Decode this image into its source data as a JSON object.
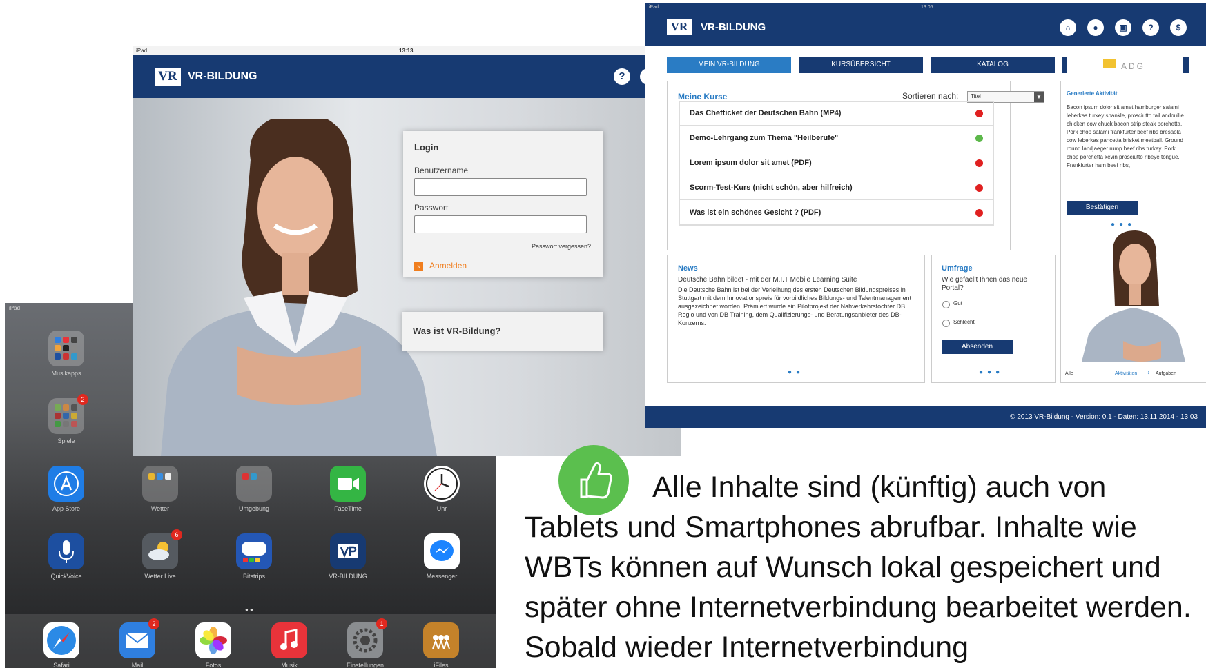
{
  "home": {
    "status": "iPad",
    "folders": [
      {
        "label": "Musikapps"
      },
      {
        "label": "Spiele",
        "badge": "2"
      }
    ],
    "apps_row1": [
      {
        "label": "App Store",
        "icon": "app-store-icon",
        "color": "#1f7de6"
      },
      {
        "label": "Wetter",
        "icon": "folder-icon",
        "color": "#6b6b6b"
      },
      {
        "label": "Umgebung",
        "icon": "folder-icon",
        "color": "#7b7b7b"
      },
      {
        "label": "FaceTime",
        "icon": "facetime-icon",
        "color": "#34b544"
      },
      {
        "label": "Uhr",
        "icon": "clock-icon",
        "color": "#ffffff"
      }
    ],
    "apps_row2": [
      {
        "label": "QuickVoice",
        "icon": "microphone-icon",
        "color": "#1d4fa0"
      },
      {
        "label": "Wetter Live",
        "icon": "weather-icon",
        "color": "#555a60",
        "badge": "6"
      },
      {
        "label": "Bitstrips",
        "icon": "speech-bubble-icon",
        "color": "#2457b5"
      },
      {
        "label": "VR-BILDUNG",
        "icon": "vr-logo-icon",
        "color": "#173a72"
      },
      {
        "label": "Messenger",
        "icon": "messenger-icon",
        "color": "#ffffff"
      }
    ],
    "dock": [
      {
        "label": "Safari",
        "icon": "safari-icon",
        "color": "#2b8ae6"
      },
      {
        "label": "Mail",
        "icon": "mail-icon",
        "color": "#2f7fe0",
        "badge": "2"
      },
      {
        "label": "Fotos",
        "icon": "photos-icon",
        "color": "#ffffff"
      },
      {
        "label": "Musik",
        "icon": "music-icon",
        "color": "#e8333a"
      },
      {
        "label": "Einstellungen",
        "icon": "settings-icon",
        "color": "#8a8d90",
        "badge": "1"
      },
      {
        "label": "iFiles",
        "icon": "files-icon",
        "color": "#c4822a"
      }
    ]
  },
  "login": {
    "status_left": "iPad",
    "status_time": "13:13",
    "brand": "VR-BILDUNG",
    "logo": "VR",
    "help": "?",
    "title": "Login",
    "username_label": "Benutzername",
    "password_label": "Passwort",
    "forgot": "Passwort vergessen?",
    "submit": "Anmelden",
    "info": "Was ist VR-Bildung?"
  },
  "portal": {
    "status_left": "iPad",
    "status_time": "13:05",
    "brand": "VR-BILDUNG",
    "logo": "VR",
    "header_icons": [
      "home-icon",
      "user-icon",
      "lock-icon",
      "help-icon",
      "dollar-icon"
    ],
    "header_glyphs": [
      "⌂",
      "●",
      "▣",
      "?",
      "$"
    ],
    "nav": [
      "MEIN VR-BILDUNG",
      "KURSÜBERSICHT",
      "KATALOG"
    ],
    "adg": "ADG",
    "courses_title": "Meine Kurse",
    "sort_label": "Sortieren nach:",
    "sort_value": "Titel",
    "courses": [
      {
        "title": "Das Chefticket der Deutschen Bahn (MP4)",
        "status": "#e02020"
      },
      {
        "title": "Demo-Lehrgang zum Thema \"Heilberufe\"",
        "status": "#5cb84a"
      },
      {
        "title": "Lorem ipsum dolor sit amet (PDF)",
        "status": "#e02020"
      },
      {
        "title": "Scorm-Test-Kurs (nicht schön, aber hilfreich)",
        "status": "#e02020"
      },
      {
        "title": "Was ist ein schönes Gesicht ? (PDF)",
        "status": "#e02020"
      }
    ],
    "activity_title": "Generierte Aktivität",
    "activity_text": "Bacon ipsum dolor sit amet hamburger salami leberkas turkey shankle, prosciutto tail andouille chicken cow chuck bacon strip steak porchetta. Pork chop salami frankfurter beef ribs bresaola cow leberkas pancetta brisket meatball. Ground round landjaeger rump beef ribs turkey. Pork chop porchetta kevin prosciutto ribeye tongue. Frankfurter ham beef ribs,",
    "confirm": "Bestätigen",
    "activity_footer": [
      "Alle",
      "Aktivitäten",
      "Aufgaben"
    ],
    "news_title": "News",
    "news_headline": "Deutsche Bahn bildet - mit der M.I.T Mobile Learning Suite",
    "news_text": "Die Deutsche Bahn ist bei der Verleihung des ersten Deutschen Bildungspreises in Stuttgart mit dem Innovationspreis für vorbildliches Bildungs- und Talentmanagement ausgezeichnet worden. Prämiert wurde ein Pilotprojekt der Nahverkehrstochter DB Regio und von DB Training, dem Qualifizierungs- und Beratungsanbieter des DB-Konzerns.",
    "poll_title": "Umfrage",
    "poll_question": "Wie gefaellt Ihnen das neue Portal?",
    "poll_options": [
      "Gut",
      "Schlecht"
    ],
    "poll_submit": "Absenden",
    "footer": "© 2013 VR-Bildung - Version: 0.1 - Daten: 13.11.2014 - 13:03"
  },
  "main_text": {
    "line1": "Alle Inhalte sind (künftig) auch von",
    "rest": "Tablets und Smartphones abrufbar. Inhalte wie WBTs können auf Wunsch lokal gespeichert und später ohne Internetverbindung bearbeitet werden. Sobald wieder Internetverbindung"
  }
}
